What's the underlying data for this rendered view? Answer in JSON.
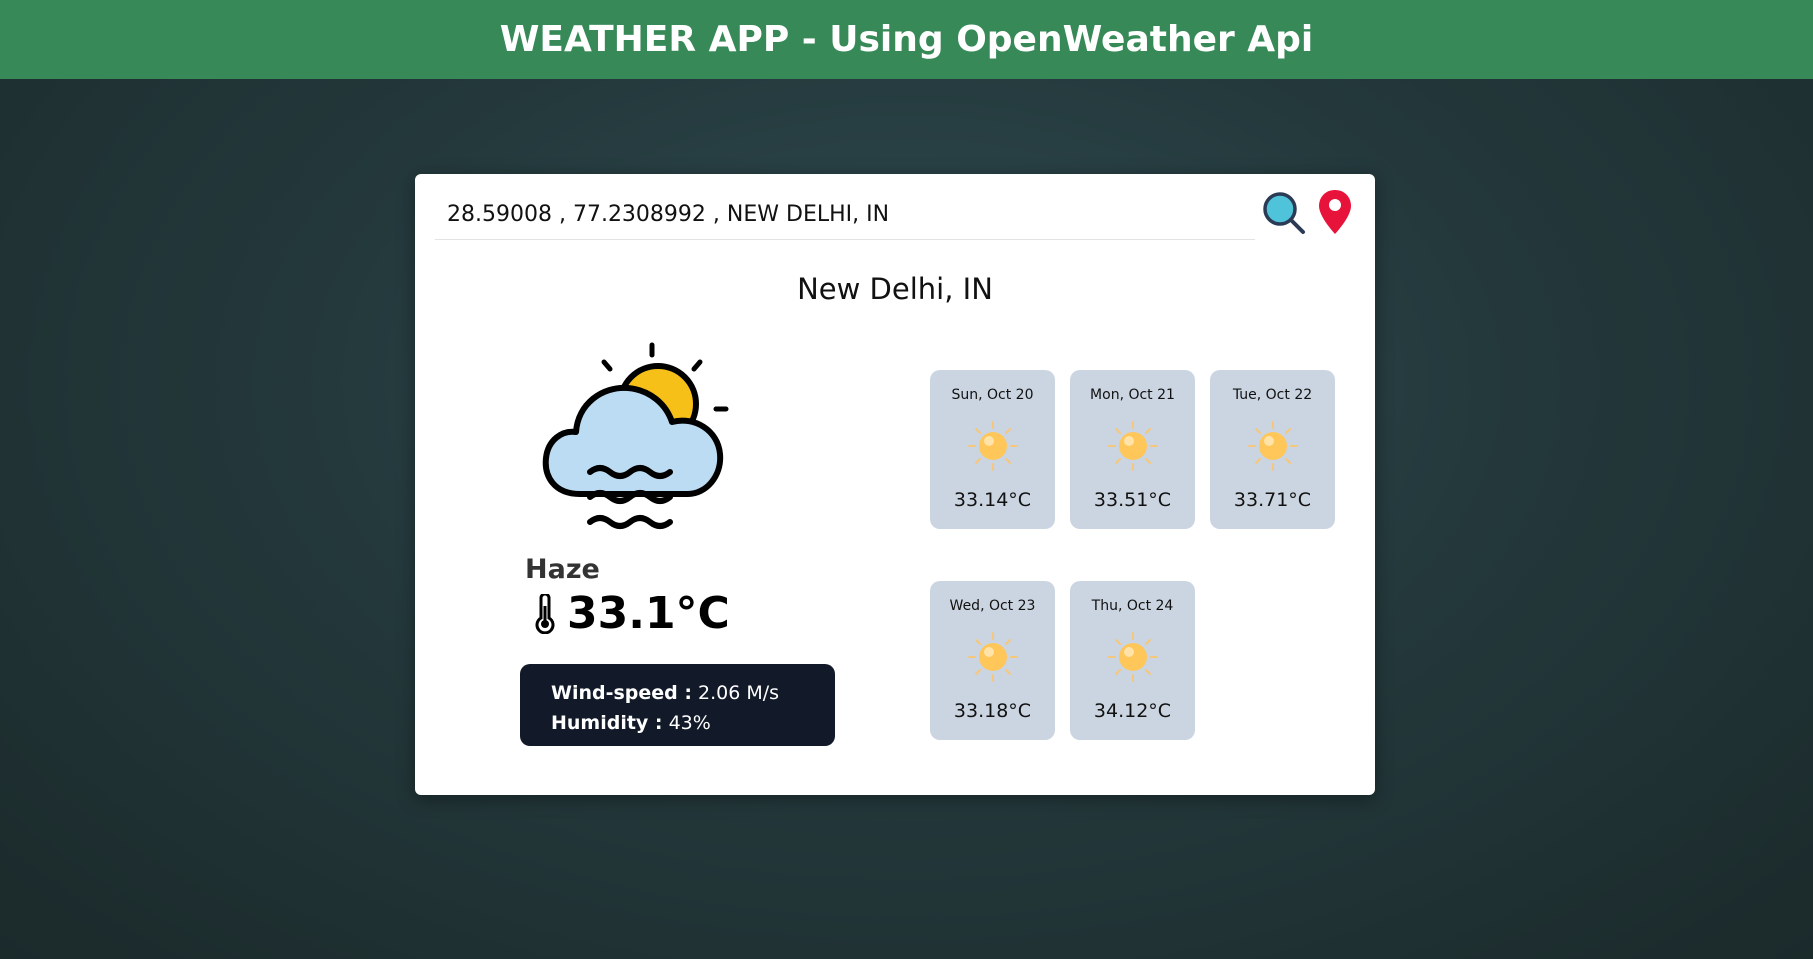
{
  "header": {
    "title": "WEATHER APP - Using OpenWeather Api"
  },
  "search": {
    "value": "28.59008 , 77.2308992 , NEW DELHI, IN"
  },
  "city": "New Delhi, IN",
  "current": {
    "condition": "Haze",
    "temperature": "33.1°C",
    "icon": "haze-cloud-sun-icon",
    "wind_label": "Wind-speed :",
    "wind_value": "2.06 M/s",
    "humidity_label": "Humidity :",
    "humidity_value": "43%"
  },
  "forecast": [
    {
      "date": "Sun, Oct 20",
      "temp": "33.14°C",
      "icon": "sun-icon"
    },
    {
      "date": "Mon, Oct 21",
      "temp": "33.51°C",
      "icon": "sun-icon"
    },
    {
      "date": "Tue, Oct 22",
      "temp": "33.71°C",
      "icon": "sun-icon"
    },
    {
      "date": "Wed, Oct 23",
      "temp": "33.18°C",
      "icon": "sun-icon"
    },
    {
      "date": "Thu, Oct 24",
      "temp": "34.12°C",
      "icon": "sun-icon"
    }
  ],
  "colors": {
    "header": "#378a58",
    "details_bg": "#121a2a",
    "forecast_card": "#cbd5e1",
    "pin": "#e8133a",
    "search_glass": "#4fc3d9"
  }
}
